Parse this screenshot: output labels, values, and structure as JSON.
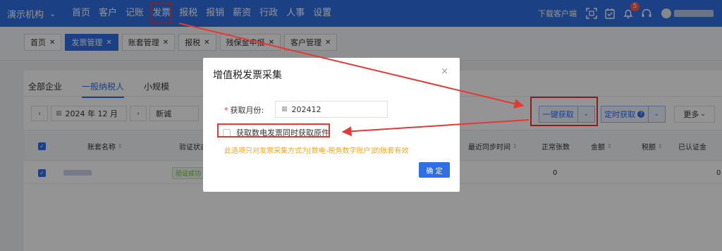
{
  "topbar": {
    "org_name": "演示机构",
    "nav_items": [
      "首页",
      "客户",
      "记账",
      "发票",
      "报税",
      "报销",
      "薪资",
      "行政",
      "人事",
      "设置"
    ],
    "download_label": "下载客户端",
    "notification_count": "5"
  },
  "tabs": [
    {
      "label": "首页"
    },
    {
      "label": "发票管理"
    },
    {
      "label": "账套管理"
    },
    {
      "label": "报税"
    },
    {
      "label": "残保金申报"
    },
    {
      "label": "客户管理"
    }
  ],
  "subtabs": [
    "全部企业",
    "一般纳税人",
    "小规模"
  ],
  "filters": {
    "prev": "‹",
    "next": "›",
    "period": "2024 年 12 月",
    "search": "新诚"
  },
  "actions": {
    "one_key_fetch": "一键获取",
    "scheduled_fetch": "定时获取",
    "more": "更多"
  },
  "table": {
    "headers": {
      "account_name": "账套名称",
      "verify_status": "验证状态",
      "last_sync": "最近同步时间",
      "normal_count": "正常张数",
      "amount": "金额",
      "tax": "税额",
      "certified": "已认证金"
    },
    "row": {
      "verify_status": "验证成功",
      "normal_count": "0",
      "certified": "0"
    }
  },
  "modal": {
    "title": "增值税发票采集",
    "month_label": "获取月份:",
    "month_value": "202412",
    "checkbox_label": "获取数电发票同时获取原件",
    "note": "此选项只对发票采集方式为[数电-税务数字账户]的账套有效",
    "confirm": "确 定",
    "close": "×"
  },
  "colors": {
    "primary": "#2f6ee4",
    "annotation": "#e53935",
    "warning": "#f5a623"
  }
}
